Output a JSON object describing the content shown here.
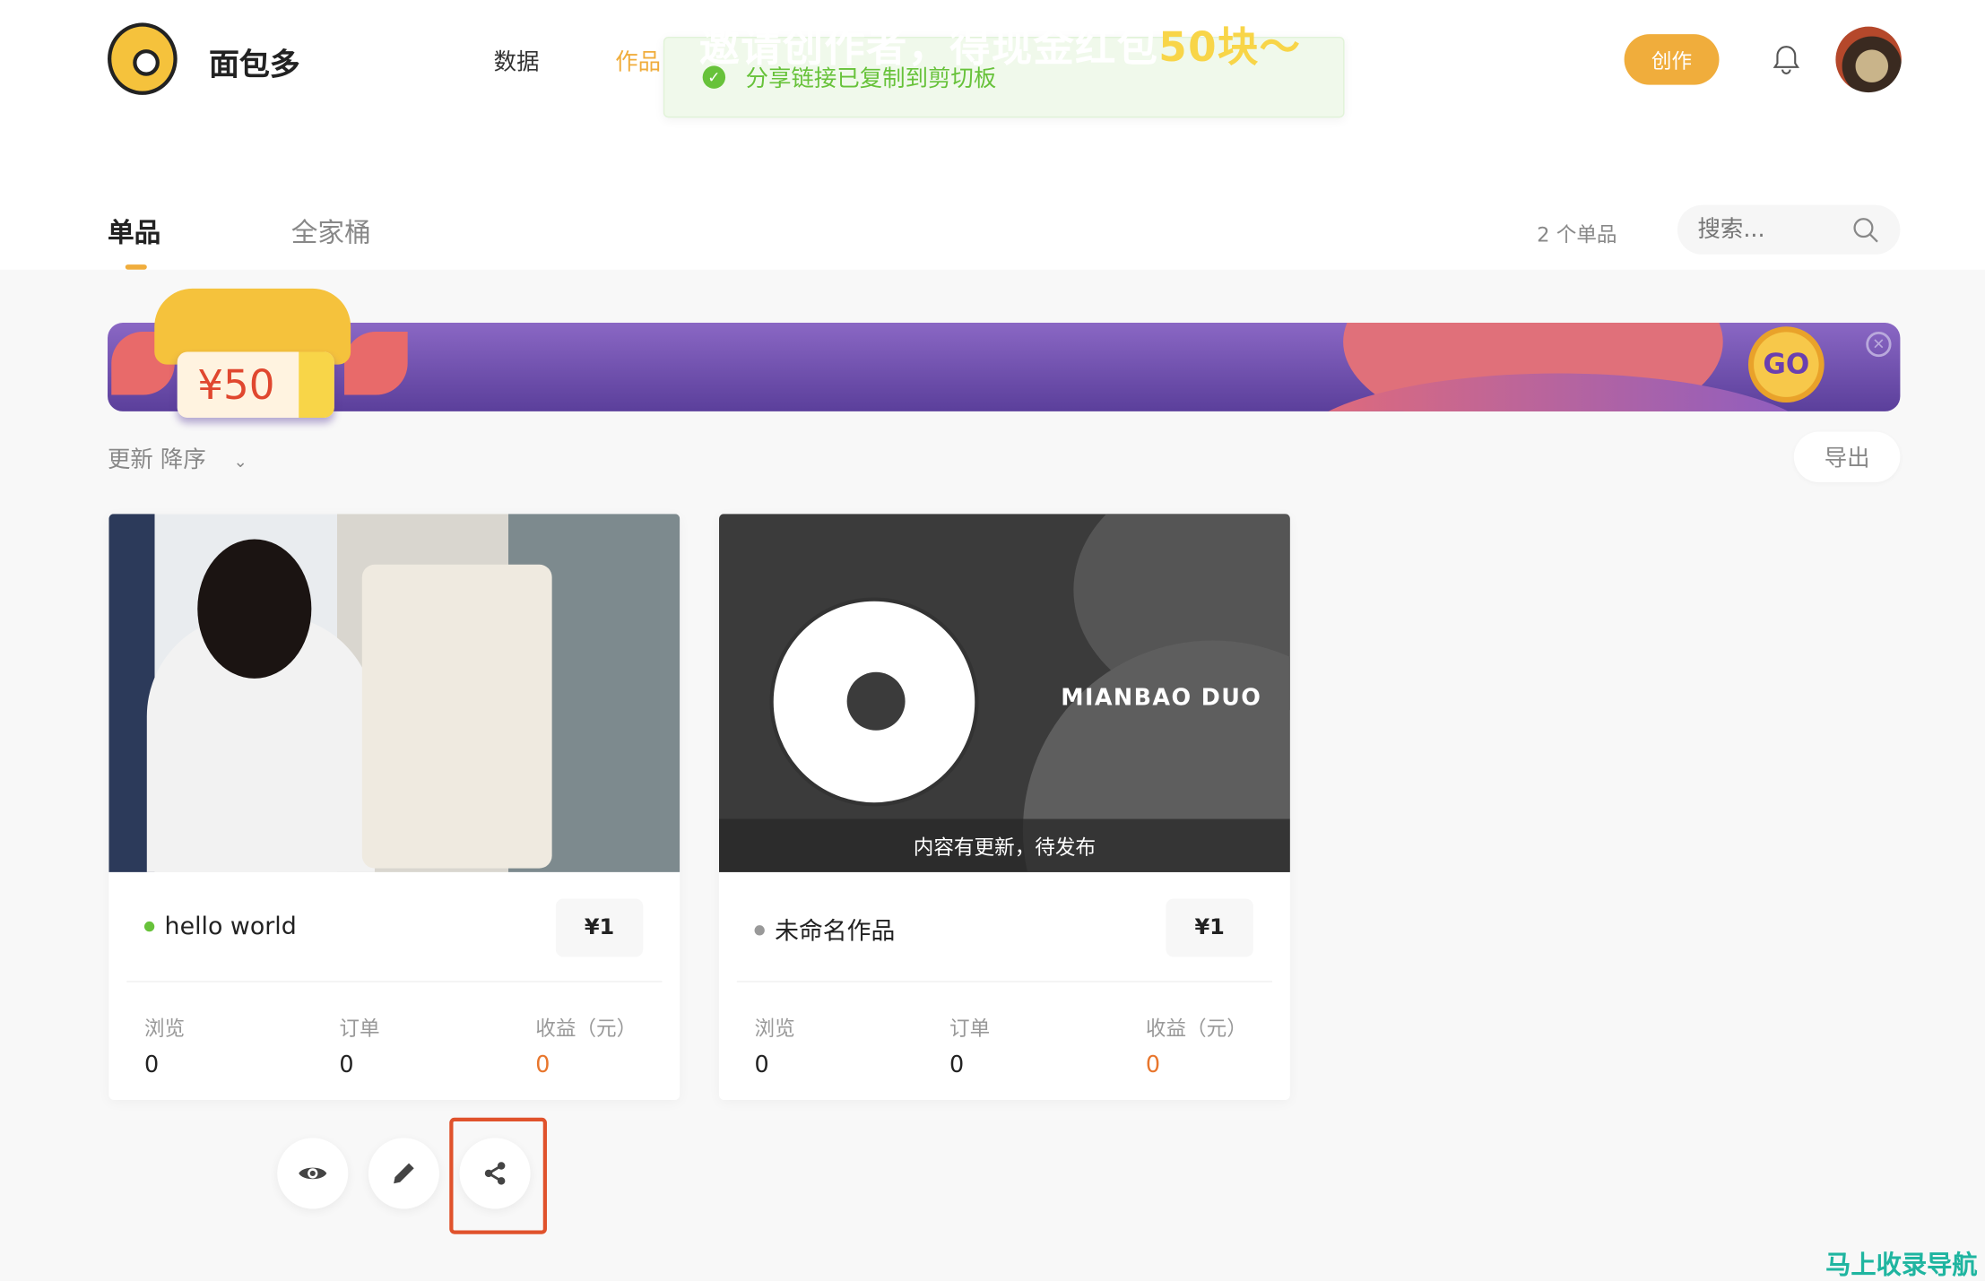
{
  "header": {
    "brand": "面包多",
    "nav": [
      "数据",
      "作品"
    ],
    "create_label": "创作",
    "bell_icon": "bell-icon"
  },
  "toast": {
    "message": "分享链接已复制到剪切板",
    "color": "#67c23a"
  },
  "tabs": [
    {
      "label": "单品",
      "active": true
    },
    {
      "label": "全家桶",
      "active": false
    }
  ],
  "toolbar": {
    "count": "2 个单品",
    "search_placeholder": "搜索...",
    "sort": "更新 降序",
    "export_label": "导出"
  },
  "banner": {
    "text": "邀请创作者，得现金红包",
    "highlight": "50块～",
    "go": "GO",
    "coupon": "¥50"
  },
  "cards": [
    {
      "title": "hello world",
      "status_color": "#67c23a",
      "price": "¥1",
      "stats": [
        {
          "label": "浏览",
          "value": "0"
        },
        {
          "label": "订单",
          "value": "0"
        },
        {
          "label": "收益（元）",
          "value": "0"
        }
      ]
    },
    {
      "title": "未命名作品",
      "status_color": "#999999",
      "price": "¥1",
      "cover_text": "MIANBAO DUO",
      "overlay": "内容有更新，待发布",
      "stats": [
        {
          "label": "浏览",
          "value": "0"
        },
        {
          "label": "订单",
          "value": "0"
        },
        {
          "label": "收益（元）",
          "value": "0"
        }
      ]
    }
  ],
  "actions": [
    "preview",
    "edit",
    "share"
  ],
  "watermark": "马上收录导航",
  "colors": {
    "accent": "#f0ad3c",
    "highlight_box": "#e0522c",
    "earnings": "#e8762d"
  }
}
